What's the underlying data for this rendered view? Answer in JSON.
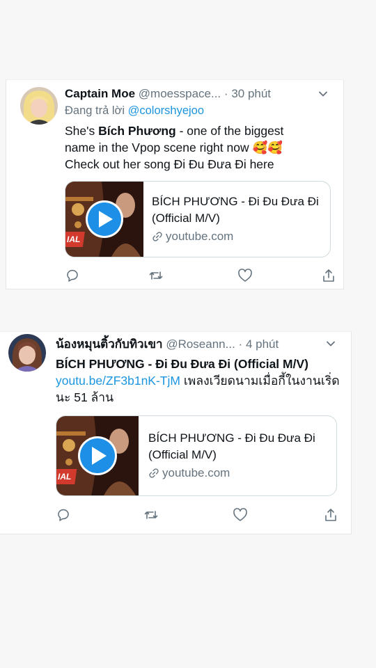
{
  "tweets": [
    {
      "author_name": "Captain Moe",
      "handle": "@moesspace...",
      "separator": "·",
      "time": "30 phút",
      "reply_prefix": "Đang trả lời",
      "reply_to": "@colorshyejoo",
      "text_part1": "She's ",
      "text_bold": "Bích Phương",
      "text_part2": " - one of the biggest name in the Vpop scene right now ",
      "text_part3": "Check out her song Đi Đu Đưa Đi here",
      "emoji": "🥰🥰",
      "card": {
        "title": "BÍCH PHƯƠNG - Đi Đu Đưa Đi (Official M/V)",
        "domain": "youtube.com",
        "thumb_label": "IAL"
      }
    },
    {
      "author_name": "น้องหมุนติ้วกับทิวเขา",
      "handle": "@Roseann...",
      "separator": "·",
      "time": "4 phút",
      "text_bold": "BÍCH PHƯƠNG - Đi Đu Đưa Đi (Official M/V)",
      "link": "youtu.be/ZF3b1nK-TjM",
      "text_part2": " เพลงเวียดนามเมื่อกี้ในงานเริ่ดนะ 51 ล้าน",
      "card": {
        "title": "BÍCH PHƯƠNG - Đi Đu Đưa Đi (Official M/V)",
        "domain": "youtube.com",
        "thumb_label": "IAL"
      }
    }
  ],
  "icons": [
    "reply-icon",
    "retweet-icon",
    "like-icon",
    "share-icon",
    "chevron-down-icon",
    "play-icon",
    "link-icon"
  ],
  "colors": {
    "link": "#1b95e0",
    "secondary_text": "#65737e",
    "play_button": "#1d8fe6",
    "border": "#cfd9de"
  }
}
